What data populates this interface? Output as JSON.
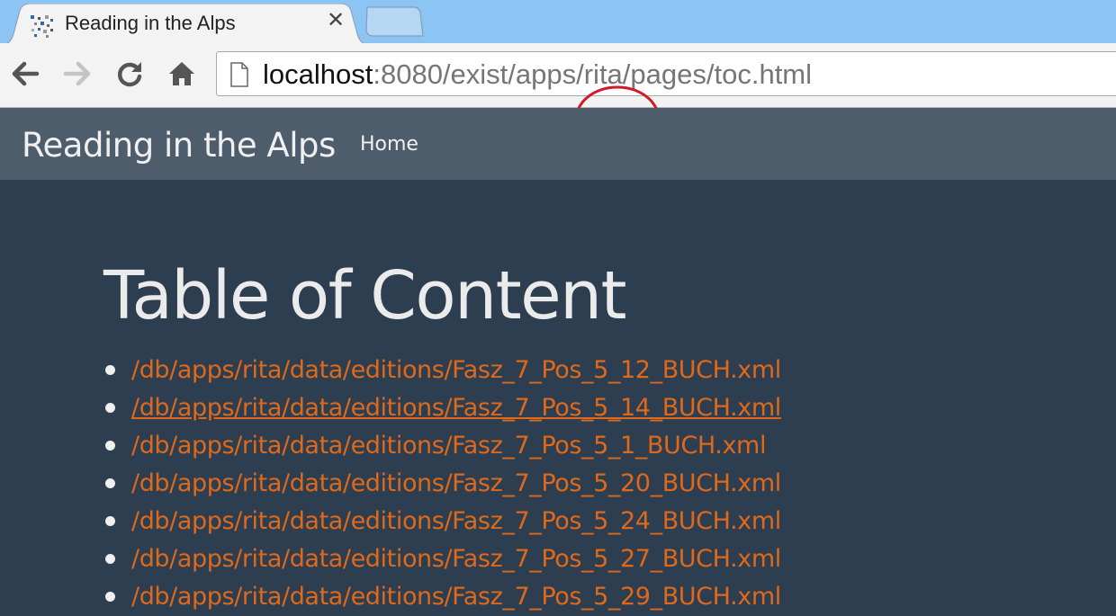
{
  "browser": {
    "tab": {
      "title": "Reading in the Alps",
      "close_glyph": "✕",
      "favicon": "site-favicon"
    },
    "new_tab": {
      "icon": "new-tab-icon"
    },
    "nav": {
      "back_icon": "back-arrow-icon",
      "forward_icon": "forward-arrow-icon",
      "reload_icon": "reload-icon",
      "home_icon": "home-icon"
    },
    "address": {
      "host": "localhost",
      "path": ":8080/exist/apps/rita/pages/toc.html",
      "annotation": "red-circle-around-rita"
    },
    "colors": {
      "titlebar": "#8cc4f4",
      "toolbar": "#f3f3f3",
      "annotation": "#d11a2a"
    }
  },
  "site": {
    "brand": "Reading in the Alps",
    "nav_home": "Home",
    "colors": {
      "navbar": "#4e5d6c",
      "background": "#2c3e50",
      "link": "#df691a",
      "text": "#ebebeb"
    }
  },
  "main": {
    "title": "Table of Content",
    "items": [
      {
        "label": "/db/apps/rita/data/editions/Fasz_7_Pos_5_12_BUCH.xml",
        "hovered": false
      },
      {
        "label": "/db/apps/rita/data/editions/Fasz_7_Pos_5_14_BUCH.xml",
        "hovered": true
      },
      {
        "label": "/db/apps/rita/data/editions/Fasz_7_Pos_5_1_BUCH.xml",
        "hovered": false
      },
      {
        "label": "/db/apps/rita/data/editions/Fasz_7_Pos_5_20_BUCH.xml",
        "hovered": false
      },
      {
        "label": "/db/apps/rita/data/editions/Fasz_7_Pos_5_24_BUCH.xml",
        "hovered": false
      },
      {
        "label": "/db/apps/rita/data/editions/Fasz_7_Pos_5_27_BUCH.xml",
        "hovered": false
      },
      {
        "label": "/db/apps/rita/data/editions/Fasz_7_Pos_5_29_BUCH.xml",
        "hovered": false
      }
    ]
  }
}
